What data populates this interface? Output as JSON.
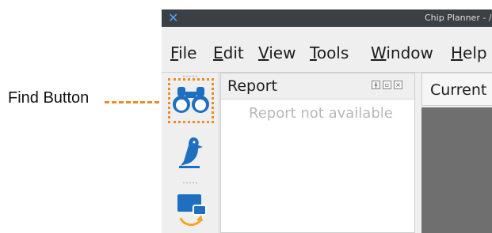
{
  "callout": {
    "label": "Find Button",
    "color": "#f08a24"
  },
  "window": {
    "title": "Chip Planner - /nf",
    "app_icon": "x-logo-icon"
  },
  "menu": [
    {
      "accel": "F",
      "rest": "ile"
    },
    {
      "accel": "E",
      "rest": "dit"
    },
    {
      "accel": "V",
      "rest": "iew"
    },
    {
      "accel": "T",
      "rest": "ools"
    },
    {
      "accel": "W",
      "rest": "indow"
    },
    {
      "accel": "H",
      "rest": "elp"
    }
  ],
  "toolbar": {
    "buttons": [
      {
        "name": "find-button",
        "icon": "binoculars-icon"
      },
      {
        "name": "bird-button",
        "icon": "bird-icon"
      },
      {
        "name": "layer-button",
        "icon": "monitor-refresh-icon"
      }
    ]
  },
  "report": {
    "title": "Report",
    "dock_buttons": [
      "pin-icon",
      "float-icon",
      "close-icon"
    ],
    "empty_message": "Report not available"
  },
  "right_tab": {
    "label": "Current"
  },
  "colors": {
    "accent": "#1e6fbf",
    "titlebar": "#3b4045",
    "canvas": "#6f6f6f"
  }
}
